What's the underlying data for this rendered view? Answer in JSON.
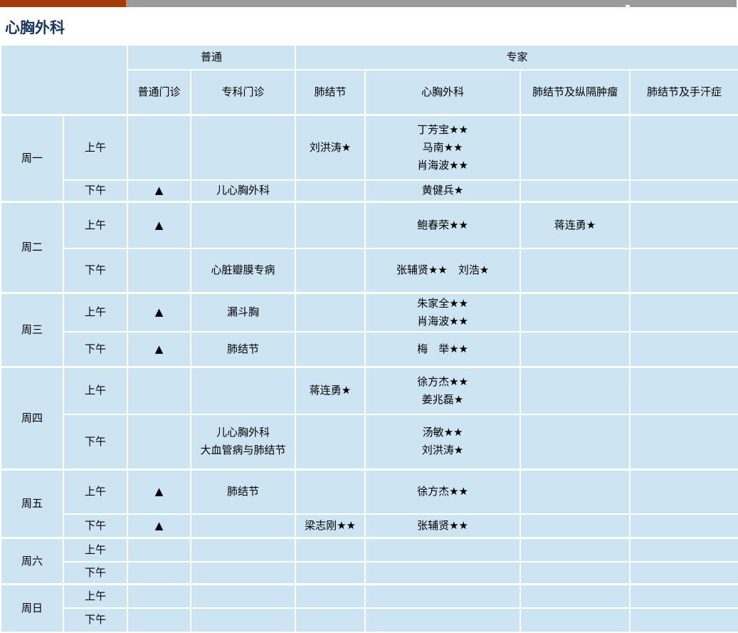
{
  "colors": {
    "accent_bar": "#A43C09",
    "gray_bar": "#9B9B9B",
    "cell_background": "#CDE5F2",
    "title_text": "#17375E",
    "grid_lines": "#FFFFFF"
  },
  "page_title": "心胸外科",
  "schedule": {
    "group_headers": {
      "normal": "普通",
      "expert": "专家"
    },
    "column_headers": [
      "普通门诊",
      "专科门诊",
      "肺结节",
      "心胸外科",
      "肺结节及纵隔肿瘤",
      "肺结节及手汗症"
    ],
    "symbols": {
      "available_marker": "▲",
      "star": "★"
    },
    "days": [
      {
        "name": "周一",
        "sessions": [
          {
            "time": "上午",
            "cells": [
              "",
              "",
              "刘洪涛★",
              "丁芳宝★★\n马南★★\n肖海波★★",
              "",
              ""
            ]
          },
          {
            "time": "下午",
            "cells": [
              "▲",
              "儿心胸外科",
              "",
              "黄健兵★",
              "",
              ""
            ]
          }
        ]
      },
      {
        "name": "周二",
        "sessions": [
          {
            "time": "上午",
            "cells": [
              "▲",
              "",
              "",
              "鲍春荣★★",
              "蒋连勇★",
              ""
            ]
          },
          {
            "time": "下午",
            "cells": [
              "",
              "心脏瓣膜专病",
              "",
              "张辅贤★★　刘浩★",
              "",
              ""
            ]
          }
        ]
      },
      {
        "name": "周三",
        "sessions": [
          {
            "time": "上午",
            "cells": [
              "▲",
              "漏斗胸",
              "",
              "朱家全★★\n肖海波★★",
              "",
              ""
            ]
          },
          {
            "time": "下午",
            "cells": [
              "▲",
              "肺结节",
              "",
              "梅　举★★",
              "",
              ""
            ]
          }
        ]
      },
      {
        "name": "周四",
        "sessions": [
          {
            "time": "上午",
            "cells": [
              "",
              "",
              "蒋连勇★",
              "徐方杰★★\n姜兆磊★",
              "",
              ""
            ]
          },
          {
            "time": "下午",
            "cells": [
              "",
              "儿心胸外科\n大血管病与肺结节",
              "",
              "汤敏★★\n刘洪涛★",
              "",
              ""
            ]
          }
        ]
      },
      {
        "name": "周五",
        "sessions": [
          {
            "time": "上午",
            "cells": [
              "▲",
              "肺结节",
              "",
              "徐方杰★★",
              "",
              ""
            ]
          },
          {
            "time": "下午",
            "cells": [
              "▲",
              "",
              "梁志刚★★",
              "张辅贤★★",
              "",
              ""
            ]
          }
        ]
      },
      {
        "name": "周六",
        "sessions": [
          {
            "time": "上午",
            "cells": [
              "",
              "",
              "",
              "",
              "",
              ""
            ]
          },
          {
            "time": "下午",
            "cells": [
              "",
              "",
              "",
              "",
              "",
              ""
            ]
          }
        ]
      },
      {
        "name": "周日",
        "sessions": [
          {
            "time": "上午",
            "cells": [
              "",
              "",
              "",
              "",
              "",
              ""
            ]
          },
          {
            "time": "下午",
            "cells": [
              "",
              "",
              "",
              "",
              "",
              ""
            ]
          }
        ]
      }
    ]
  }
}
